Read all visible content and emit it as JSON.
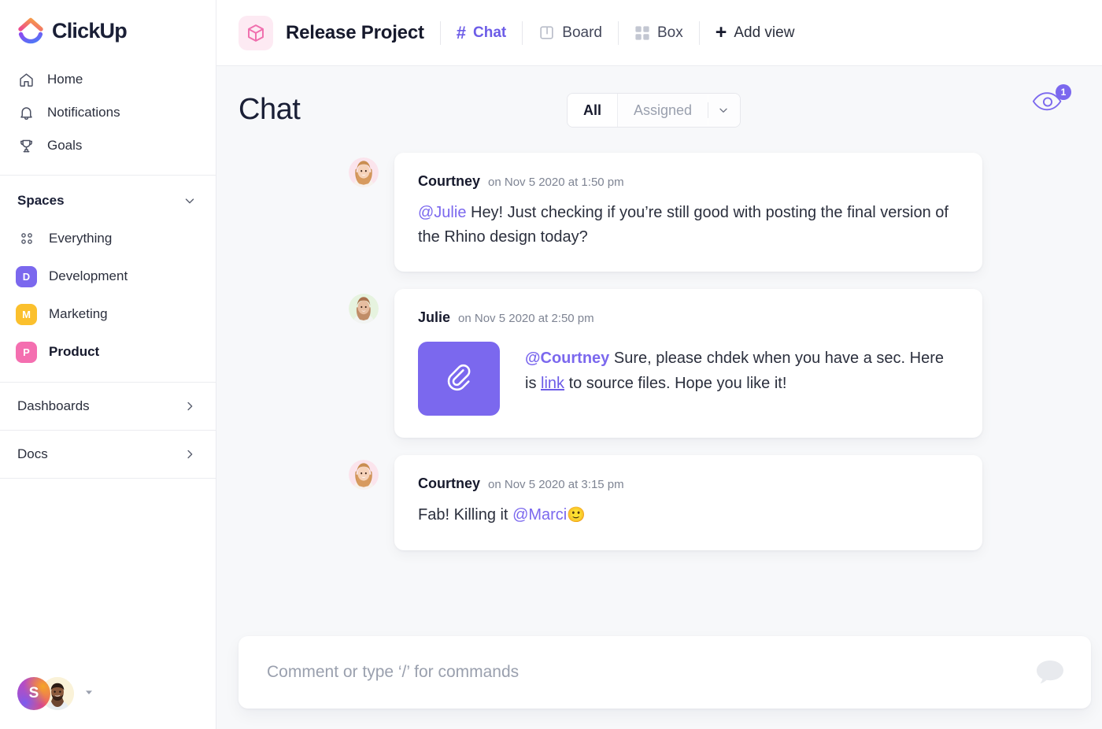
{
  "brand": {
    "name": "ClickUp",
    "accent": "#7b68ee",
    "logo_icon": "clickup-logo-icon",
    "logo_colors": [
      "#ed4b8e",
      "#f7a93b",
      "#4a7bf7",
      "#8a4bf0"
    ]
  },
  "sidebar": {
    "nav": [
      {
        "label": "Home",
        "icon": "home-icon"
      },
      {
        "label": "Notifications",
        "icon": "bell-icon"
      },
      {
        "label": "Goals",
        "icon": "trophy-icon"
      }
    ],
    "spaces_section": {
      "title": "Spaces",
      "collapse_icon": "chevron-down-icon"
    },
    "spaces": [
      {
        "label": "Everything",
        "icon": "grid-dots-icon",
        "initial": "",
        "color": "",
        "active": false
      },
      {
        "label": "Development",
        "icon": "space-badge",
        "initial": "D",
        "color": "#7b68ee",
        "active": false
      },
      {
        "label": "Marketing",
        "icon": "space-badge",
        "initial": "M",
        "color": "#fbc02d",
        "active": false
      },
      {
        "label": "Product",
        "icon": "space-badge",
        "initial": "P",
        "color": "#f46fb0",
        "active": true
      }
    ],
    "links": [
      {
        "label": "Dashboards",
        "icon": "chevron-right-icon"
      },
      {
        "label": "Docs",
        "icon": "chevron-right-icon"
      }
    ],
    "footer": {
      "workspace_initial": "S",
      "workspace_avatar_icon": "workspace-avatar",
      "user_avatar_icon": "user-avatar",
      "caret_icon": "caret-down-icon"
    }
  },
  "topbar": {
    "project_icon": "cube-icon",
    "project_name": "Release Project",
    "tabs": [
      {
        "label": "Chat",
        "icon": "hash-icon",
        "active": true
      },
      {
        "label": "Board",
        "icon": "board-icon",
        "active": false
      },
      {
        "label": "Box",
        "icon": "box-grid-icon",
        "active": false
      }
    ],
    "add_view": {
      "label": "Add view",
      "icon": "plus-icon"
    }
  },
  "content": {
    "page_title": "Chat",
    "filter": {
      "options": [
        "All",
        "Assigned"
      ],
      "selected": "All",
      "caret_icon": "chevron-down-icon"
    },
    "watchers": {
      "icon": "eye-icon",
      "count": "1"
    }
  },
  "messages": [
    {
      "author": "Courtney",
      "time": "on Nov 5 2020 at 1:50 pm",
      "avatar": "avatar-courtney",
      "avatar_bg": "#fbe6ec",
      "mention": "@Julie",
      "text": " Hey! Just checking if you’re still good with posting the final version of the Rhino design today?",
      "has_attachment": false
    },
    {
      "author": "Julie",
      "time": "on Nov 5 2020 at 2:50 pm",
      "avatar": "avatar-julie",
      "avatar_bg": "#e5f3e0",
      "mention": "@Courtney",
      "text_part1": " Sure, please chdek when you have a sec. Here is ",
      "link_text": "link",
      "text_part2": " to source files. Hope you like it!",
      "has_attachment": true,
      "attachment_icon": "paperclip-icon",
      "attachment_color": "#7b68ee"
    },
    {
      "author": "Courtney",
      "time": "on Nov 5 2020 at 3:15 pm",
      "avatar": "avatar-courtney",
      "avatar_bg": "#fbe6ec",
      "text_before": "Fab! Killing it ",
      "mention": "@Marci",
      "emoji": "🙂",
      "has_attachment": false
    }
  ],
  "composer": {
    "placeholder": "Comment or type ‘/’ for commands",
    "value": "",
    "bubble_icon": "comment-bubble-icon"
  }
}
